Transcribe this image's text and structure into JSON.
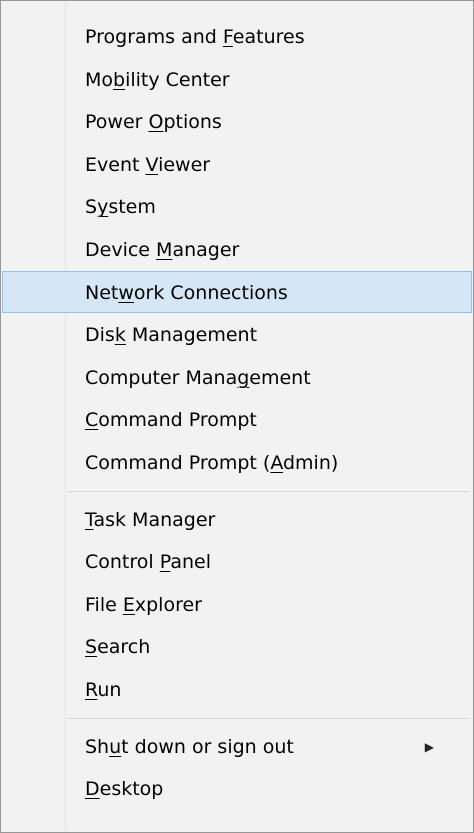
{
  "menu": {
    "groups": [
      [
        {
          "pre": "Programs and ",
          "key": "F",
          "post": "eatures",
          "highlighted": false
        },
        {
          "pre": "Mo",
          "key": "b",
          "post": "ility Center",
          "highlighted": false
        },
        {
          "pre": "Power ",
          "key": "O",
          "post": "ptions",
          "highlighted": false
        },
        {
          "pre": "Event ",
          "key": "V",
          "post": "iewer",
          "highlighted": false
        },
        {
          "pre": "S",
          "key": "y",
          "post": "stem",
          "highlighted": false
        },
        {
          "pre": "Device ",
          "key": "M",
          "post": "anager",
          "highlighted": false
        },
        {
          "pre": "Net",
          "key": "w",
          "post": "ork Connections",
          "highlighted": true
        },
        {
          "pre": "Dis",
          "key": "k",
          "post": " Management",
          "highlighted": false
        },
        {
          "pre": "Computer Mana",
          "key": "g",
          "post": "ement",
          "highlighted": false
        },
        {
          "pre": "",
          "key": "C",
          "post": "ommand Prompt",
          "highlighted": false
        },
        {
          "pre": "Command Prompt (",
          "key": "A",
          "post": "dmin)",
          "highlighted": false
        }
      ],
      [
        {
          "pre": "",
          "key": "T",
          "post": "ask Manager",
          "highlighted": false
        },
        {
          "pre": "Control ",
          "key": "P",
          "post": "anel",
          "highlighted": false
        },
        {
          "pre": "File ",
          "key": "E",
          "post": "xplorer",
          "highlighted": false
        },
        {
          "pre": "",
          "key": "S",
          "post": "earch",
          "highlighted": false
        },
        {
          "pre": "",
          "key": "R",
          "post": "un",
          "highlighted": false
        }
      ],
      [
        {
          "pre": "Sh",
          "key": "u",
          "post": "t down or sign out",
          "highlighted": false,
          "submenu": true
        },
        {
          "pre": "",
          "key": "D",
          "post": "esktop",
          "highlighted": false
        }
      ]
    ],
    "submenu_arrow_icon": "arrow-right-icon",
    "colors": {
      "background": "#f2f2f2",
      "highlight_fill": "#d5e6f7",
      "highlight_border": "#90c1ee",
      "separator": "#d6d6d6"
    }
  }
}
